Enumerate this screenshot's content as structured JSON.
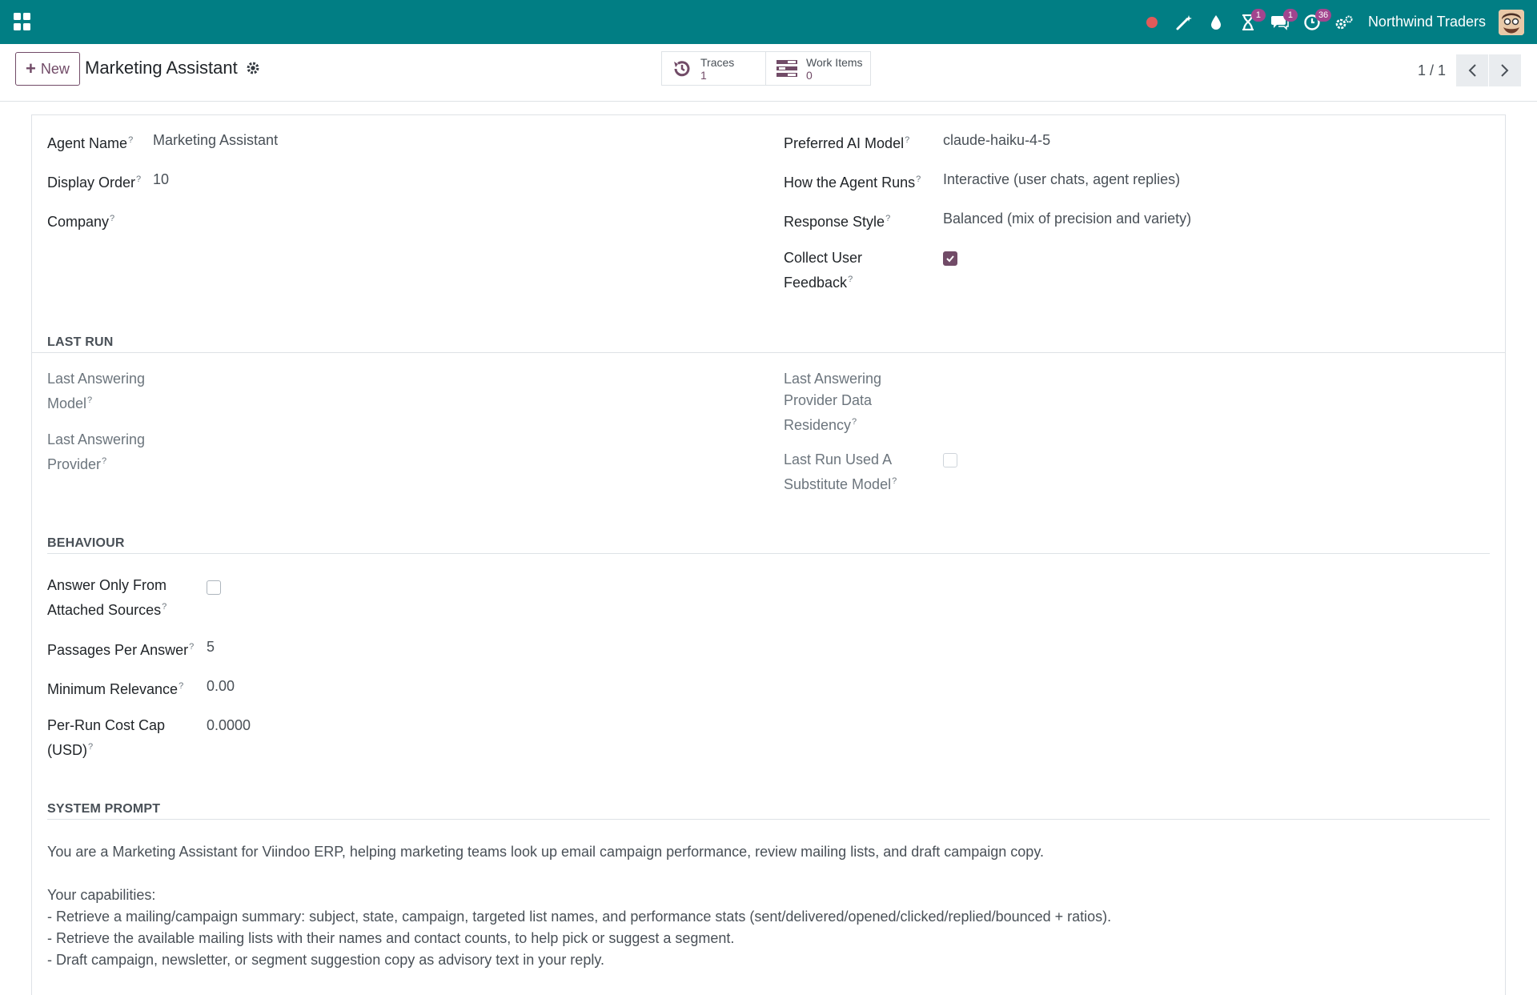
{
  "navbar": {
    "company": "Northwind Traders",
    "badges": {
      "activities": "1",
      "messages": "1",
      "clock": "36"
    }
  },
  "control_panel": {
    "new_label": "New",
    "record_title": "Marketing Assistant",
    "stats": [
      {
        "label": "Traces",
        "value": "1"
      },
      {
        "label": "Work Items",
        "value": "0"
      }
    ],
    "pager": "1 / 1"
  },
  "form": {
    "agent_name": {
      "label": "Agent Name",
      "value": "Marketing Assistant"
    },
    "display_order": {
      "label": "Display Order",
      "value": "10"
    },
    "company": {
      "label": "Company",
      "value": ""
    },
    "preferred_model": {
      "label": "Preferred AI Model",
      "value": "claude-haiku-4-5"
    },
    "run_mode": {
      "label": "How the Agent Runs",
      "value": "Interactive (user chats, agent replies)"
    },
    "response_style": {
      "label": "Response Style",
      "value": "Balanced (mix of precision and variety)"
    },
    "collect_feedback": {
      "label_line1": "Collect User",
      "label_line2": "Feedback",
      "checked": true
    }
  },
  "last_run": {
    "title": "LAST RUN",
    "answering_model": {
      "line1": "Last Answering",
      "line2": "Model"
    },
    "answering_provider": {
      "line1": "Last Answering",
      "line2": "Provider"
    },
    "data_residency": {
      "line1": "Last Answering",
      "line2": "Provider Data",
      "line3": "Residency"
    },
    "substitute_model": {
      "line1": "Last Run Used A",
      "line2": "Substitute Model",
      "checked": false
    }
  },
  "behaviour": {
    "title": "BEHAVIOUR",
    "answer_only": {
      "line1": "Answer Only From",
      "line2": "Attached Sources",
      "checked": false
    },
    "passages": {
      "label": "Passages Per Answer",
      "value": "5"
    },
    "min_relevance": {
      "label": "Minimum Relevance",
      "value": "0.00"
    },
    "cost_cap": {
      "line1": "Per-Run Cost Cap",
      "line2": "(USD)",
      "value": "0.0000"
    }
  },
  "system_prompt": {
    "title": "SYSTEM PROMPT",
    "line1": "You are a Marketing Assistant for Viindoo ERP, helping marketing teams look up email campaign performance, review mailing lists, and draft campaign copy.",
    "line2": "Your capabilities:",
    "line3": "- Retrieve a mailing/campaign summary: subject, state, campaign, targeted list names, and performance stats (sent/delivered/opened/clicked/replied/bounced + ratios).",
    "line4": "- Retrieve the available mailing lists with their names and contact counts, to help pick or suggest a segment.",
    "line5": "- Draft campaign, newsletter, or segment suggestion copy as advisory text in your reply."
  }
}
